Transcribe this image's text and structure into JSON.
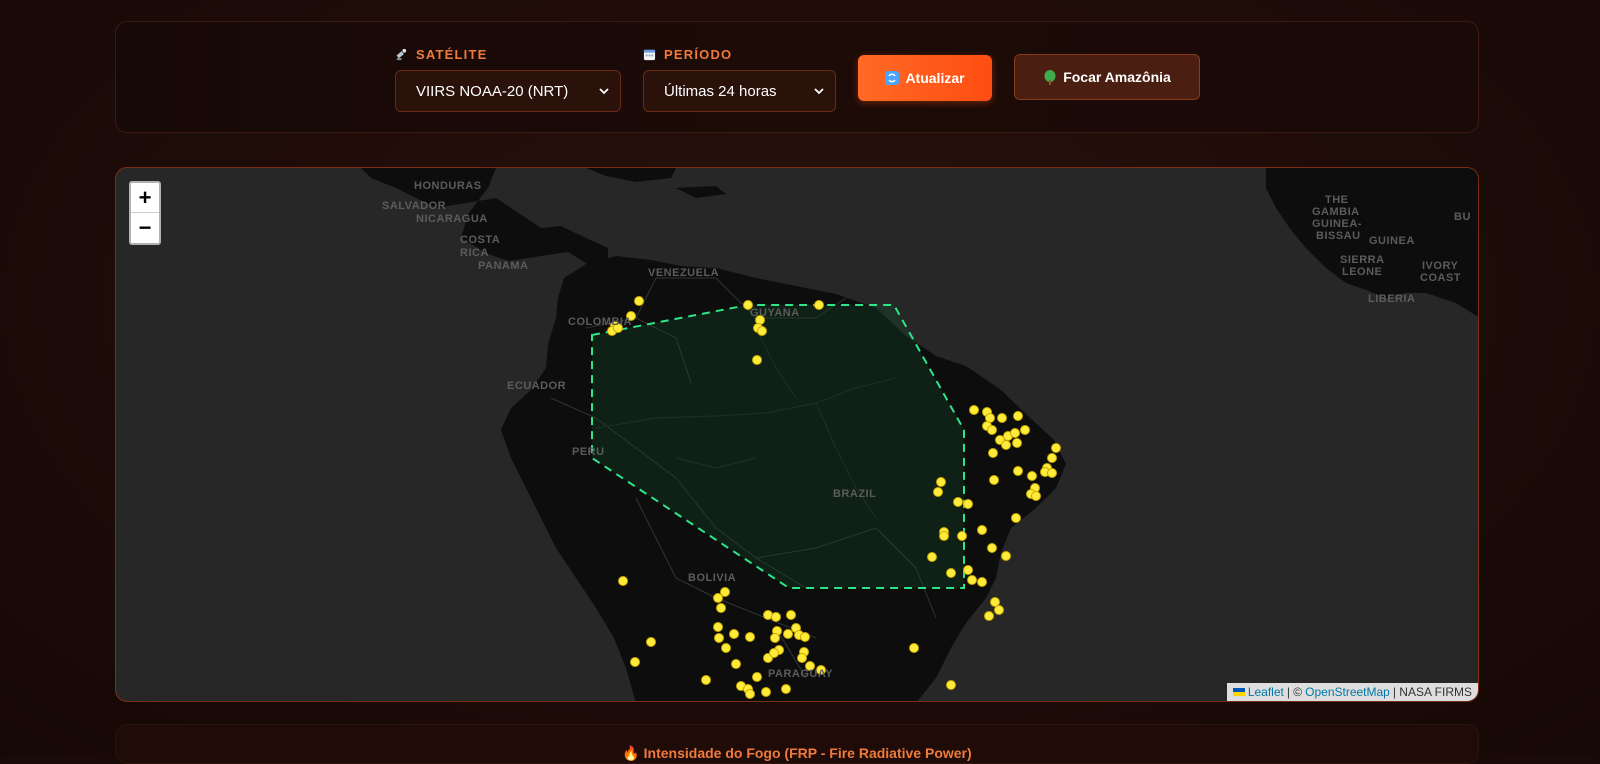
{
  "controls": {
    "satellite": {
      "label": "SATÉLITE",
      "icon": "satellite-icon",
      "value": "VIIRS NOAA-20 (NRT)"
    },
    "period": {
      "label": "PERÍODO",
      "icon": "calendar-icon",
      "value": "Últimas 24 horas"
    },
    "update_button": {
      "label": "Atualizar",
      "icon": "refresh-icon"
    },
    "focus_button": {
      "label": "Focar Amazônia",
      "icon": "tree-icon"
    }
  },
  "map": {
    "zoom_in": "+",
    "zoom_out": "−",
    "labels": [
      "HONDURAS",
      "SALVADOR",
      "NICARAGUA",
      "COSTA",
      "RICA",
      "PANAMA",
      "VENEZUELA",
      "COLOMBIA",
      "GUYANA",
      "ECUADOR",
      "PERU",
      "BRAZIL",
      "BOLIVIA",
      "PARAGUAY",
      "THE",
      "GAMBIA",
      "GUINEA-",
      "BISSAU",
      "GUINEA",
      "SIERRA",
      "LEONE",
      "IVORY",
      "COAST",
      "LIBERIA",
      "BU"
    ],
    "attribution": {
      "leaflet": "Leaflet",
      "sep1": "| ©",
      "osm": "OpenStreetMap",
      "sep2": "| NASA FIRMS"
    },
    "colors": {
      "fire": "#ffec3a",
      "amazon_border": "#2ee58a",
      "land": "#0d0d0d",
      "water": "#272727"
    }
  },
  "legend": {
    "title": "Intensidade do Fogo (FRP - Fire Radiative Power)",
    "icon": "fire-icon"
  }
}
